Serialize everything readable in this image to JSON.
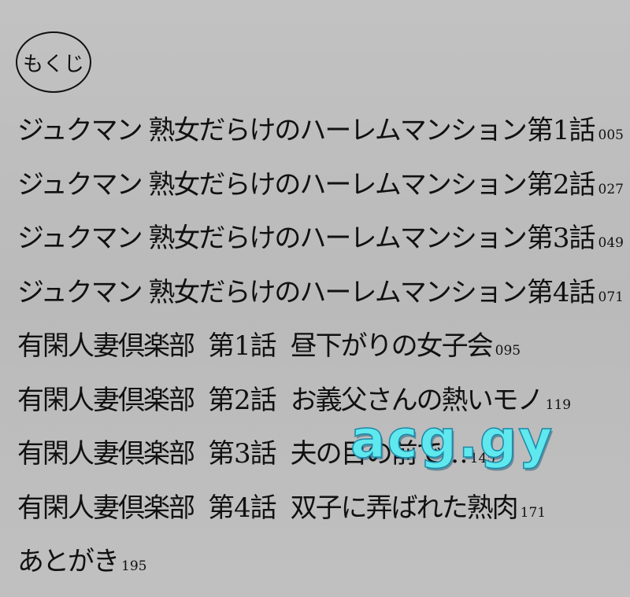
{
  "heading": "もくじ",
  "entries": [
    {
      "series": "ジュクマン 熟女だらけのハーレムマンション",
      "episode": "第1話",
      "title": "",
      "page": "005"
    },
    {
      "series": "ジュクマン 熟女だらけのハーレムマンション",
      "episode": "第2話",
      "title": "",
      "page": "027"
    },
    {
      "series": "ジュクマン 熟女だらけのハーレムマンション",
      "episode": "第3話",
      "title": "",
      "page": "049"
    },
    {
      "series": "ジュクマン 熟女だらけのハーレムマンション",
      "episode": "第4話",
      "title": "",
      "page": "071"
    },
    {
      "series": "有閑人妻倶楽部",
      "episode": "第1話",
      "title": "昼下がりの女子会",
      "page": "095"
    },
    {
      "series": "有閑人妻倶楽部",
      "episode": "第2話",
      "title": "お義父さんの熱いモノ",
      "page": "119"
    },
    {
      "series": "有閑人妻倶楽部",
      "episode": "第3話",
      "title": "夫の目の前で…",
      "page": "145"
    },
    {
      "series": "有閑人妻倶楽部",
      "episode": "第4話",
      "title": "双子に弄ばれた熟肉",
      "page": "171"
    },
    {
      "series": "あとがき",
      "episode": "",
      "title": "",
      "page": "195"
    }
  ],
  "watermark": "acg.gy"
}
